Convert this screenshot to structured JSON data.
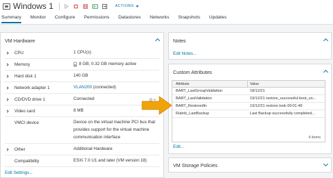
{
  "header": {
    "vm_name": "Windows 1",
    "actions_label": "ACTIONS"
  },
  "tabs": [
    "Summary",
    "Monitor",
    "Configure",
    "Permissions",
    "Datastores",
    "Networks",
    "Snapshots",
    "Updates"
  ],
  "vm_hardware": {
    "title": "VM Hardware",
    "rows": [
      {
        "label": "CPU",
        "value": "1 CPU(s)"
      },
      {
        "label": "Memory",
        "value": "8 GB, 0.32 GB memory active"
      },
      {
        "label": "Hard disk 1",
        "value": "140 GB"
      },
      {
        "label": "Network adapter 1",
        "value_link": "VLAN200",
        "value_suffix": " (connected)"
      },
      {
        "label": "CD/DVD drive 1",
        "value": "Connected"
      },
      {
        "label": "Video card",
        "value": "8 MB"
      },
      {
        "label": "VMCI device",
        "value_lines": [
          "Device on the virtual machine PCI bus that",
          "provides support for the virtual machine",
          "communication interface"
        ]
      },
      {
        "label": "Other",
        "value": "Additional Hardware"
      },
      {
        "label": "Compatibility",
        "value": "ESXi 7.0 U1 and later (VM version 18)"
      }
    ],
    "edit_link": "Edit Settings..."
  },
  "notes": {
    "title": "Notes",
    "edit_link": "Edit Notes..."
  },
  "custom_attributes": {
    "title": "Custom Attributes",
    "columns": [
      "Attribute",
      "Value"
    ],
    "rows": [
      {
        "attribute": "BART_LastGroupValidation",
        "value": "18/12/21"
      },
      {
        "attribute": "BART_LastValidation",
        "value": "19/12/21 restore_successful boot_un..."
      },
      {
        "attribute": "BART_RestoredIn",
        "value": "19/12/21 restore took 00:01:49"
      },
      {
        "attribute": "Rubrik_LastBackup",
        "value": "Last Backup successfully completed..."
      }
    ],
    "items_count": "4 items",
    "edit_link": "Edit..."
  },
  "storage_policies": {
    "title": "VM Storage Policies"
  },
  "colors": {
    "accent": "#0072a3",
    "arrow": "#f0a30a"
  }
}
